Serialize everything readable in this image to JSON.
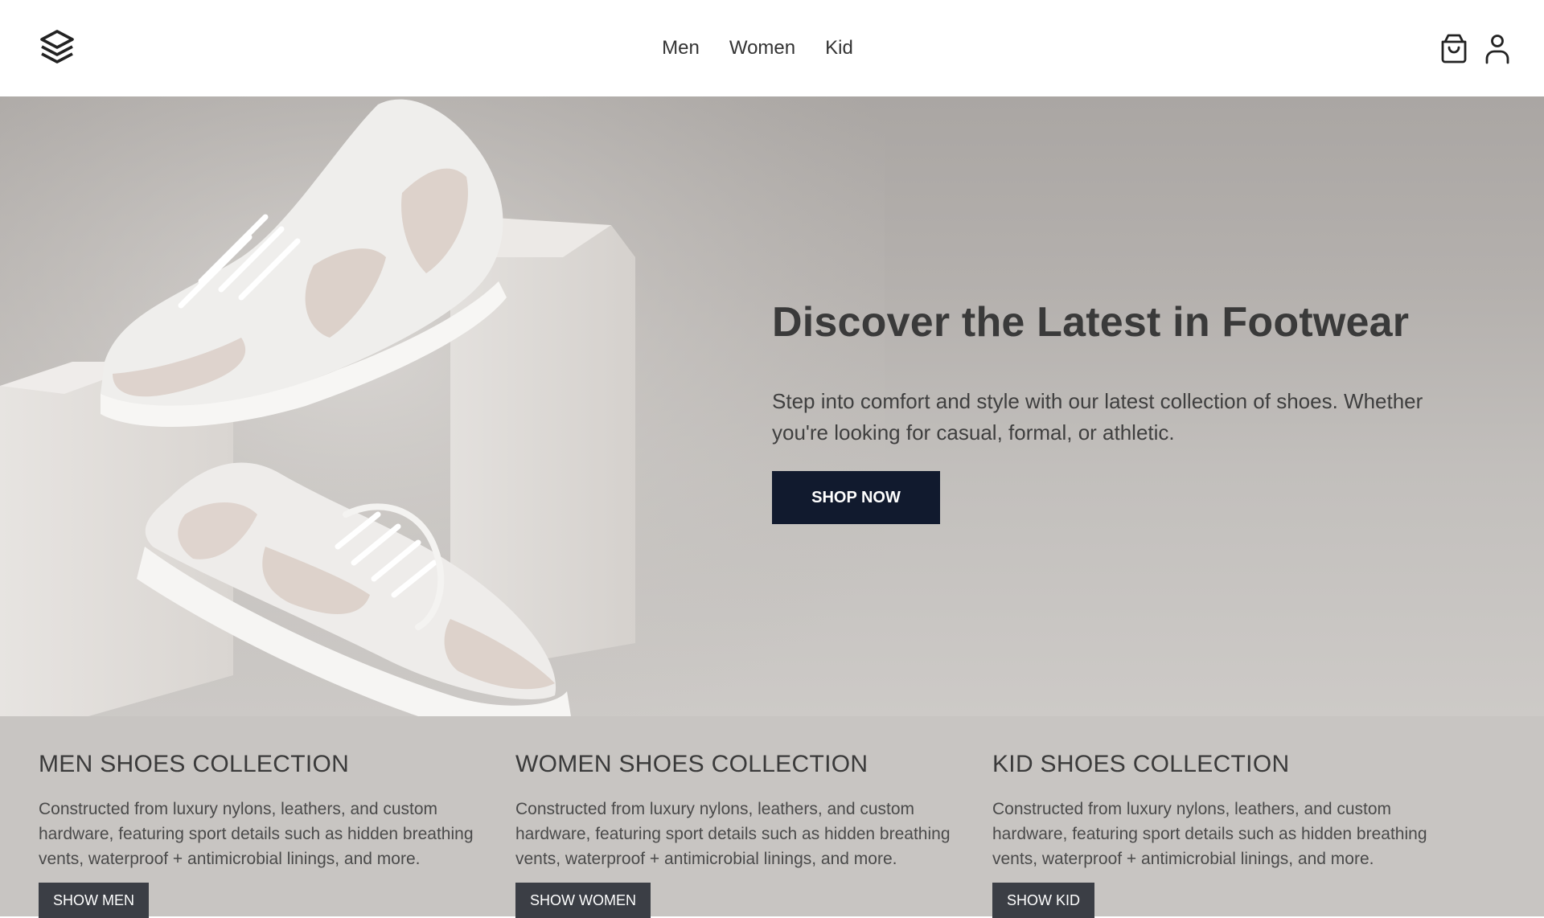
{
  "header": {
    "logo_icon": "stacked-layers-logo",
    "nav": [
      {
        "label": "Men"
      },
      {
        "label": "Women"
      },
      {
        "label": "Kid"
      }
    ],
    "icons": [
      "shopping-bag-icon",
      "user-icon"
    ]
  },
  "hero": {
    "title": "Discover the Latest in Footwear",
    "description": "Step into comfort and style with our latest collection of shoes. Whether you're looking for casual, formal, or athletic.",
    "cta_label": "SHOP NOW",
    "image": "white-sneakers-on-blocks"
  },
  "collections": [
    {
      "title": "MEN SHOES COLLECTION",
      "description": "Constructed from luxury nylons, leathers, and custom hardware, featuring sport details such as hidden breathing vents, waterproof + antimicrobial linings, and more.",
      "button": "SHOW MEN"
    },
    {
      "title": "WOMEN SHOES COLLECTION",
      "description": "Constructed from luxury nylons, leathers, and custom hardware, featuring sport details such as hidden breathing vents, waterproof + antimicrobial linings, and more.",
      "button": "SHOW WOMEN"
    },
    {
      "title": "KID SHOES COLLECTION",
      "description": "Constructed from luxury nylons, leathers, and custom hardware, featuring sport details such as hidden breathing vents, waterproof + antimicrobial linings, and more.",
      "button": "SHOW KID"
    }
  ],
  "colors": {
    "cta_background": "#111a2e",
    "collection_button": "#3b3e45",
    "collections_background": "#c8c5c2"
  }
}
